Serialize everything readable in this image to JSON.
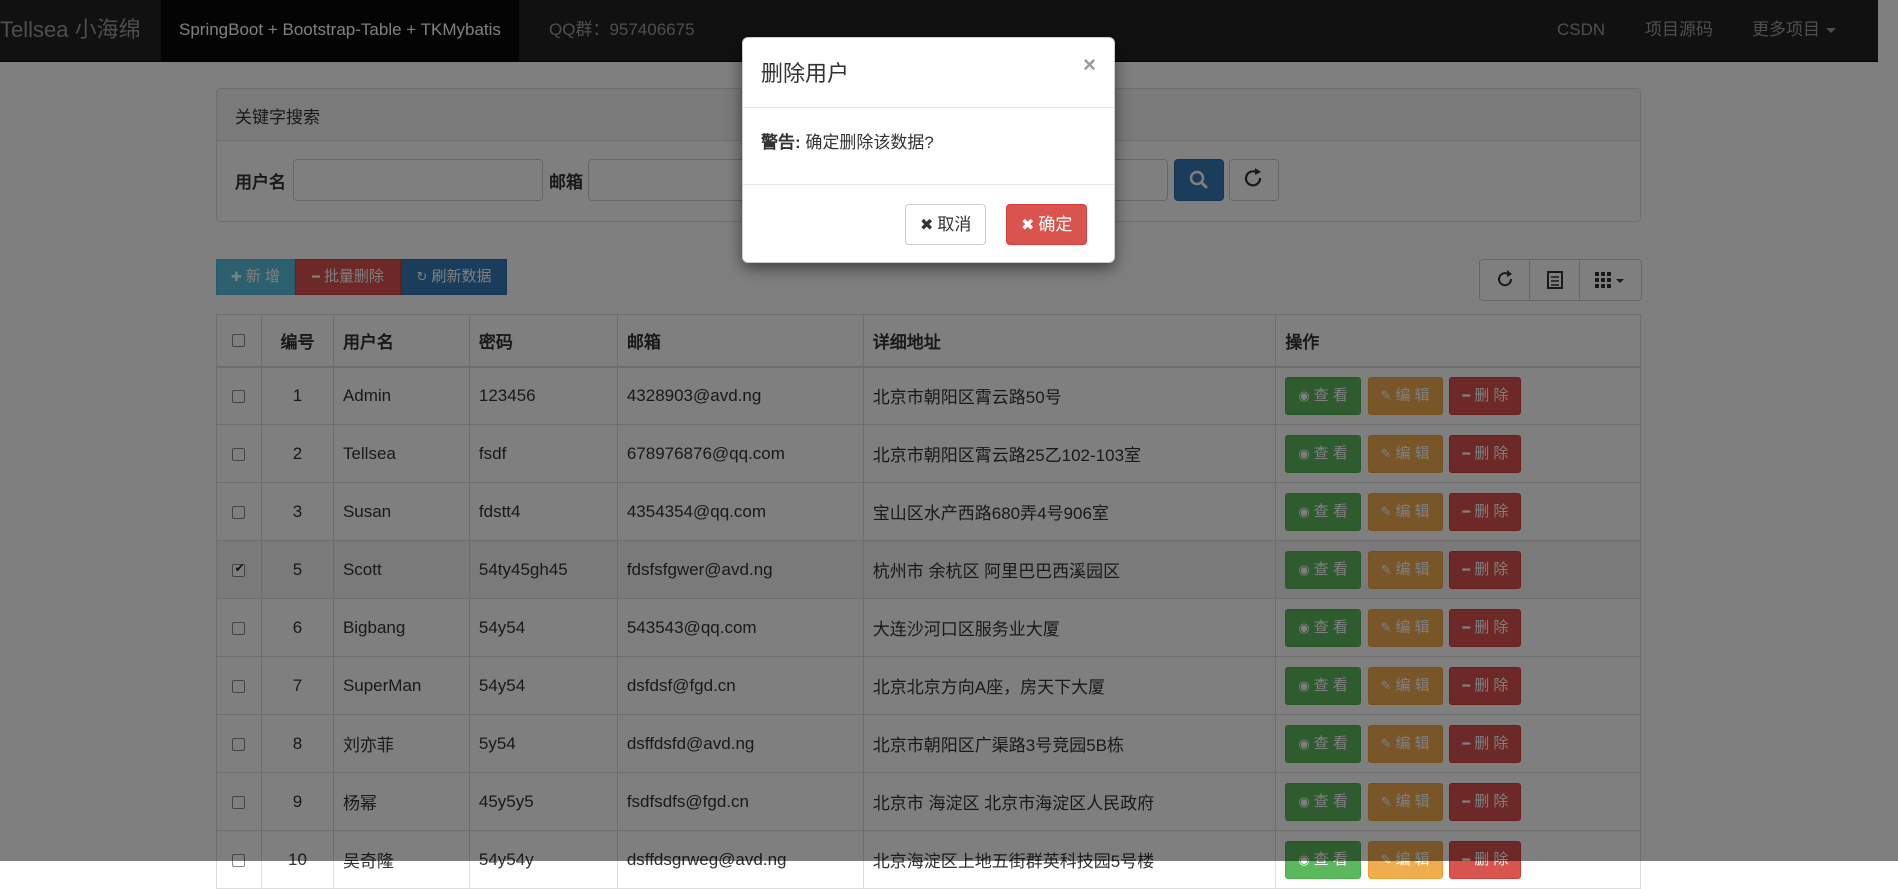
{
  "navbar": {
    "brand": "Tellsea 小海绵",
    "active_item": "SpringBoot + Bootstrap-Table + TKMybatis",
    "qq": "QQ群：957406675",
    "links": [
      "CSDN",
      "项目源码",
      "更多项目"
    ]
  },
  "search": {
    "heading": "关键字搜索",
    "username_label": "用户名",
    "email_label": "邮箱",
    "username_value": "",
    "email_value": ""
  },
  "toolbar": {
    "add_label": "新 增",
    "batch_delete_label": "批量删除",
    "refresh_label": "刷新数据"
  },
  "table": {
    "headers": [
      "编号",
      "用户名",
      "密码",
      "邮箱",
      "详细地址",
      "操作"
    ],
    "action_labels": {
      "view": "查 看",
      "edit": "编 辑",
      "delete": "删 除"
    },
    "rows": [
      {
        "id": "1",
        "username": "Admin",
        "password": "123456",
        "email": "4328903@avd.ng",
        "address": "北京市朝阳区霄云路50号",
        "checked": false
      },
      {
        "id": "2",
        "username": "Tellsea",
        "password": "fsdf",
        "email": "678976876@qq.com",
        "address": "北京市朝阳区霄云路25乙102-103室",
        "checked": false
      },
      {
        "id": "3",
        "username": "Susan",
        "password": "fdstt4",
        "email": "4354354@qq.com",
        "address": "宝山区水产西路680弄4号906室",
        "checked": false
      },
      {
        "id": "5",
        "username": "Scott",
        "password": "54ty45gh45",
        "email": "fdsfsfgwer@avd.ng",
        "address": "杭州市 余杭区 阿里巴巴西溪园区",
        "checked": true
      },
      {
        "id": "6",
        "username": "Bigbang",
        "password": "54y54",
        "email": "543543@qq.com",
        "address": "大连沙河口区服务业大厦",
        "checked": false
      },
      {
        "id": "7",
        "username": "SuperMan",
        "password": "54y54",
        "email": "dsfdsf@fgd.cn",
        "address": "北京北京方向A座，房天下大厦",
        "checked": false
      },
      {
        "id": "8",
        "username": "刘亦菲",
        "password": "5y54",
        "email": "dsffdsfd@avd.ng",
        "address": "北京市朝阳区广渠路3号竞园5B栋",
        "checked": false
      },
      {
        "id": "9",
        "username": "杨幂",
        "password": "45y5y5",
        "email": "fsdfsdfs@fgd.cn",
        "address": "北京市 海淀区 北京市海淀区人民政府",
        "checked": false
      },
      {
        "id": "10",
        "username": "吴奇隆",
        "password": "54y54y",
        "email": "dsffdsgrweg@avd.ng",
        "address": "北京海淀区上地五街群英科技园5号楼",
        "checked": false
      }
    ]
  },
  "modal": {
    "title": "删除用户",
    "close": "×",
    "warning_label": "警告:",
    "message": "确定删除该数据?",
    "cancel_label": "取消",
    "confirm_label": "确定"
  },
  "colors": {
    "primary": "#337ab7",
    "success": "#5cb85c",
    "warning": "#f0ad4e",
    "danger": "#d9534f",
    "info": "#5bc0de",
    "navbar": "#222222"
  }
}
